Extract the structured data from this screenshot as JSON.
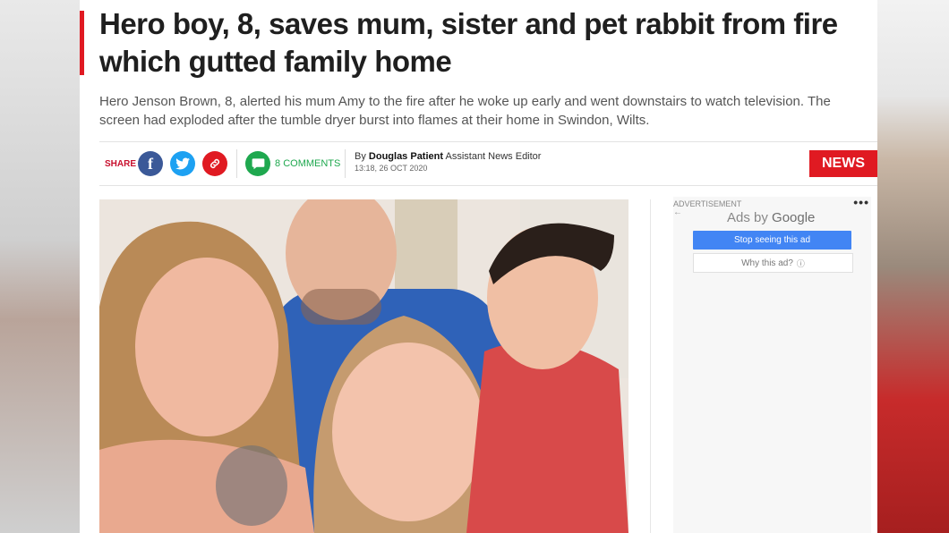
{
  "article": {
    "headline": "Hero boy, 8, saves mum, sister and pet rabbit from fire which gutted family home",
    "standfirst": "Hero Jenson Brown, 8, alerted his mum Amy to the fire after he woke up early and went downstairs to watch television. The screen had exploded after the tumble dryer burst into flames at their home in Swindon, Wilts."
  },
  "share": {
    "label": "SHARE",
    "comments_count": "8",
    "comments_label": "COMMENTS"
  },
  "byline": {
    "prefix": "By",
    "author": "Douglas Patient",
    "role": "Assistant News Editor",
    "timestamp": "13:18, 26 OCT 2020"
  },
  "section_badge": "NEWS",
  "advert": {
    "label": "ADVERTISEMENT",
    "ads_by": "Ads by",
    "google": "Google",
    "stop_label": "Stop seeing this ad",
    "why_label": "Why this ad?"
  },
  "colors": {
    "accent": "#e01a22",
    "facebook": "#3b5998",
    "twitter": "#1da1f2",
    "comments": "#1fa84f",
    "ad_button": "#4285f4"
  },
  "icons": [
    "facebook-icon",
    "twitter-icon",
    "link-icon",
    "comment-icon",
    "back-arrow-icon",
    "more-options-icon",
    "info-icon"
  ]
}
